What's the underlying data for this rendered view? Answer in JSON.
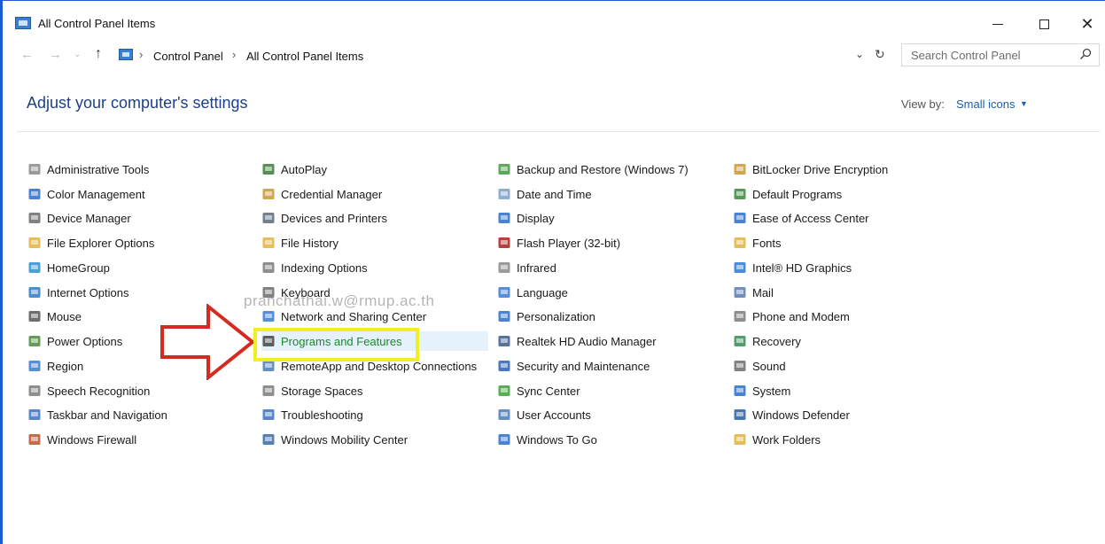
{
  "window": {
    "title": "All Control Panel Items",
    "minimize_label": "",
    "maximize_label": "",
    "close_label": "✕"
  },
  "nav": {
    "back": "←",
    "forward": "→",
    "recent": "⌄",
    "up": "↑",
    "crumb_sep": "›",
    "breadcrumbs": [
      "Control Panel",
      "All Control Panel Items"
    ],
    "dropdown": "⌄",
    "refresh": "↻"
  },
  "search": {
    "placeholder": "Search Control Panel"
  },
  "header": {
    "title": "Adjust your computer's settings",
    "view_by_label": "View by:",
    "view_by_value": "Small icons",
    "view_by_caret": "▼"
  },
  "watermark": "pranchathai.w@rmup.ac.th",
  "columns": [
    [
      {
        "label": "Administrative Tools",
        "icon": "admin-tools-icon",
        "color": "#8a8a8a"
      },
      {
        "label": "Color Management",
        "icon": "color-management-icon",
        "color": "#2a6fc9"
      },
      {
        "label": "Device Manager",
        "icon": "device-manager-icon",
        "color": "#6b6b6b"
      },
      {
        "label": "File Explorer Options",
        "icon": "folder-options-icon",
        "color": "#e0b13c"
      },
      {
        "label": "HomeGroup",
        "icon": "homegroup-icon",
        "color": "#2a8fd1"
      },
      {
        "label": "Internet Options",
        "icon": "internet-options-icon",
        "color": "#2a7ac2"
      },
      {
        "label": "Mouse",
        "icon": "mouse-icon",
        "color": "#555555"
      },
      {
        "label": "Power Options",
        "icon": "power-options-icon",
        "color": "#4a8a3a"
      },
      {
        "label": "Region",
        "icon": "region-icon",
        "color": "#3a7ad2"
      },
      {
        "label": "Speech Recognition",
        "icon": "microphone-icon",
        "color": "#7a7a7a"
      },
      {
        "label": "Taskbar and Navigation",
        "icon": "taskbar-icon",
        "color": "#3b72c0"
      },
      {
        "label": "Windows Firewall",
        "icon": "firewall-icon",
        "color": "#b5522e"
      }
    ],
    [
      {
        "label": "AutoPlay",
        "icon": "autoplay-icon",
        "color": "#3a7a3a"
      },
      {
        "label": "Credential Manager",
        "icon": "credential-manager-icon",
        "color": "#c9962e"
      },
      {
        "label": "Devices and Printers",
        "icon": "devices-printers-icon",
        "color": "#5a6a7a"
      },
      {
        "label": "File History",
        "icon": "file-history-icon",
        "color": "#e0b13c"
      },
      {
        "label": "Indexing Options",
        "icon": "indexing-options-icon",
        "color": "#7a7a7a"
      },
      {
        "label": "Keyboard",
        "icon": "keyboard-icon",
        "color": "#6b6b6b"
      },
      {
        "label": "Network and Sharing Center",
        "icon": "network-icon",
        "color": "#3a7ad2"
      },
      {
        "label": "Programs and Features",
        "icon": "programs-features-icon",
        "color": "#444444"
      },
      {
        "label": "RemoteApp and Desktop Connections",
        "icon": "remoteapp-icon",
        "color": "#4a7ab8"
      },
      {
        "label": "Storage Spaces",
        "icon": "storage-spaces-icon",
        "color": "#7a7a7a"
      },
      {
        "label": "Troubleshooting",
        "icon": "troubleshooting-icon",
        "color": "#3b72c0"
      },
      {
        "label": "Windows Mobility Center",
        "icon": "mobility-center-icon",
        "color": "#3a6aa8"
      }
    ],
    [
      {
        "label": "Backup and Restore (Windows 7)",
        "icon": "backup-restore-icon",
        "color": "#3e9a3e"
      },
      {
        "label": "Date and Time",
        "icon": "date-time-icon",
        "color": "#7aa0c8"
      },
      {
        "label": "Display",
        "icon": "display-icon",
        "color": "#2a6fc9"
      },
      {
        "label": "Flash Player (32-bit)",
        "icon": "flash-player-icon",
        "color": "#a8201a"
      },
      {
        "label": "Infrared",
        "icon": "infrared-icon",
        "color": "#8a8a8a"
      },
      {
        "label": "Language",
        "icon": "language-icon",
        "color": "#3a7ad2"
      },
      {
        "label": "Personalization",
        "icon": "personalization-icon",
        "color": "#2a6fc9"
      },
      {
        "label": "Realtek HD Audio Manager",
        "icon": "realtek-audio-icon",
        "color": "#3a5a8a"
      },
      {
        "label": "Security and Maintenance",
        "icon": "flag-icon",
        "color": "#2a5fb4"
      },
      {
        "label": "Sync Center",
        "icon": "sync-center-icon",
        "color": "#3aa03a"
      },
      {
        "label": "User Accounts",
        "icon": "user-accounts-icon",
        "color": "#4a7ab8"
      },
      {
        "label": "Windows To Go",
        "icon": "windows-to-go-icon",
        "color": "#2a6fc9"
      }
    ],
    [
      {
        "label": "BitLocker Drive Encryption",
        "icon": "bitlocker-icon",
        "color": "#c9962e"
      },
      {
        "label": "Default Programs",
        "icon": "default-programs-icon",
        "color": "#3a8a3a"
      },
      {
        "label": "Ease of Access Center",
        "icon": "ease-of-access-icon",
        "color": "#2a6fc9"
      },
      {
        "label": "Fonts",
        "icon": "fonts-icon",
        "color": "#e0b13c"
      },
      {
        "label": "Intel® HD Graphics",
        "icon": "intel-graphics-icon",
        "color": "#2a7ad2"
      },
      {
        "label": "Mail",
        "icon": "mail-icon",
        "color": "#5a7ab0"
      },
      {
        "label": "Phone and Modem",
        "icon": "phone-modem-icon",
        "color": "#7a7a7a"
      },
      {
        "label": "Recovery",
        "icon": "recovery-icon",
        "color": "#3a8a5a"
      },
      {
        "label": "Sound",
        "icon": "sound-icon",
        "color": "#6b6b6b"
      },
      {
        "label": "System",
        "icon": "system-icon",
        "color": "#2a6fc9"
      },
      {
        "label": "Windows Defender",
        "icon": "windows-defender-icon",
        "color": "#2a5fa0"
      },
      {
        "label": "Work Folders",
        "icon": "work-folders-icon",
        "color": "#e0b13c"
      }
    ]
  ],
  "selected_item": "Programs and Features",
  "annotation": {
    "arrow_color": "#d42a22",
    "highlight_color": "#f1ee22"
  }
}
